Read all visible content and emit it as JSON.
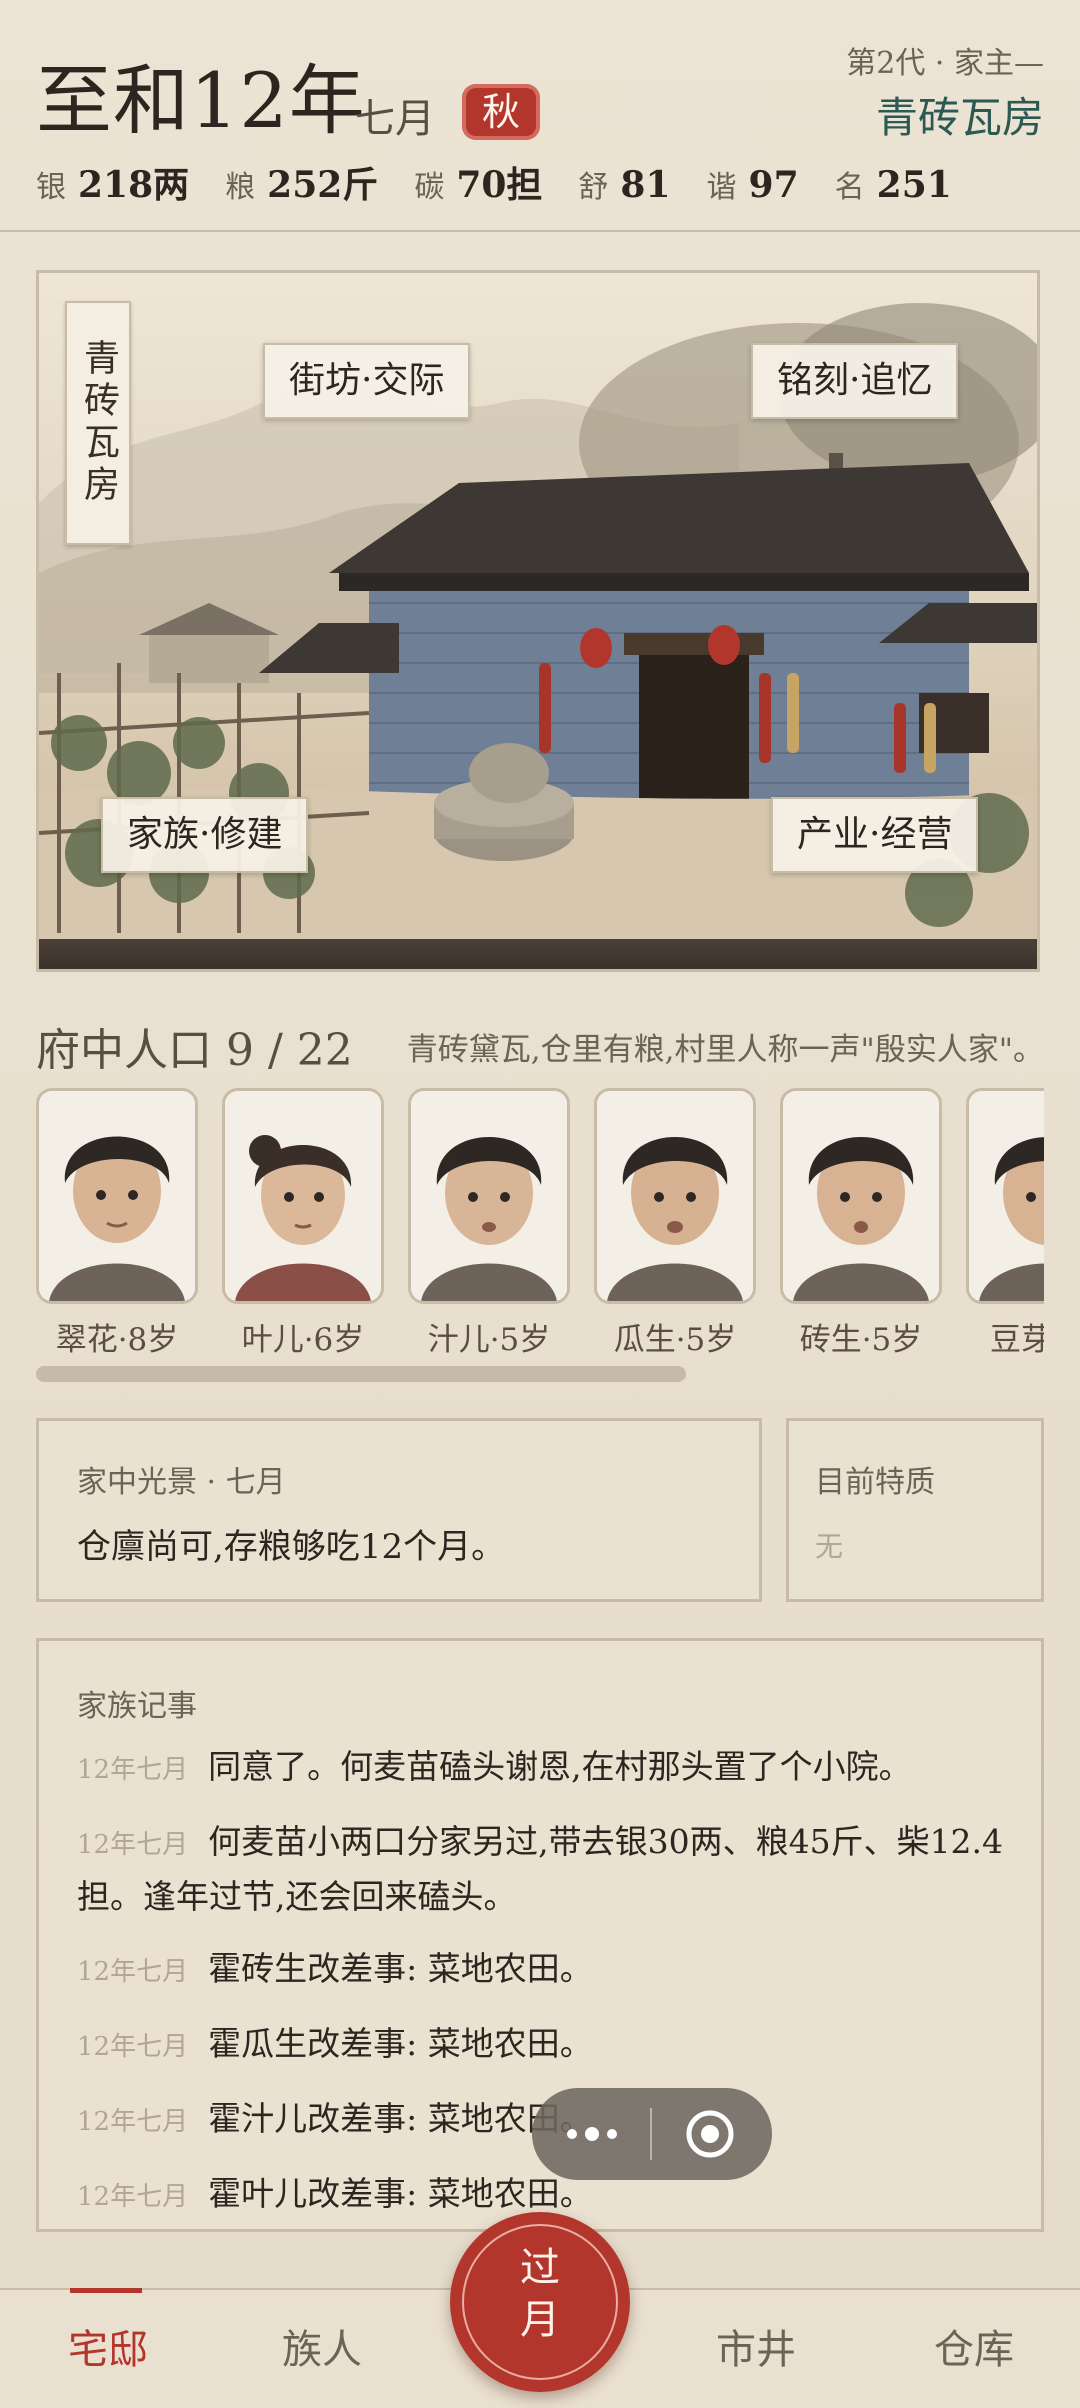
{
  "header": {
    "era": "至和12年",
    "month": "七月",
    "season": "秋",
    "generation": "第2代 · 家主—",
    "house_name": "青砖瓦房",
    "stats": [
      {
        "label": "银",
        "value": "218两"
      },
      {
        "label": "粮",
        "value": "252斤"
      },
      {
        "label": "碳",
        "value": "70担"
      },
      {
        "label": "舒",
        "value": "81"
      },
      {
        "label": "谐",
        "value": "97"
      },
      {
        "label": "名",
        "value": "251"
      }
    ]
  },
  "scene": {
    "vertical_sign": "青砖瓦房",
    "buttons": {
      "street": "街坊·交际",
      "memorial": "铭刻·追忆",
      "build": "家族·修建",
      "business": "产业·经营"
    }
  },
  "population": {
    "title": "府中人口 9 / 22",
    "description": "青砖黛瓦,仓里有粮,村里人称一声\"殷实人家\"。",
    "people": [
      {
        "name": "翠花·8岁"
      },
      {
        "name": "叶儿·6岁"
      },
      {
        "name": "汁儿·5岁"
      },
      {
        "name": "瓜生·5岁"
      },
      {
        "name": "砖生·5岁"
      },
      {
        "name": "豆芽"
      }
    ]
  },
  "status_card": {
    "label": "家中光景 · 七月",
    "text": "仓廪尚可,存粮够吃12个月。"
  },
  "trait_card": {
    "label": "目前特质",
    "value": "无"
  },
  "log": {
    "title": "家族记事",
    "entries": [
      {
        "date": "12年七月",
        "text": "同意了。何麦苗磕头谢恩,在村那头置了个小院。"
      },
      {
        "date": "12年七月",
        "text": "何麦苗小两口分家另过,带去银30两、粮45斤、柴12.4担。逢年过节,还会回来磕头。"
      },
      {
        "date": "12年七月",
        "text": "霍砖生改差事: 菜地农田。"
      },
      {
        "date": "12年七月",
        "text": "霍瓜生改差事: 菜地农田。"
      },
      {
        "date": "12年七月",
        "text": "霍汁儿改差事: 菜地农田。"
      },
      {
        "date": "12年七月",
        "text": "霍叶儿改差事: 菜地农田。"
      }
    ]
  },
  "nav": {
    "home": "宅邸",
    "clan": "族人",
    "advance": "过月",
    "market": "市井",
    "warehouse": "仓库"
  },
  "colors": {
    "accent_red": "#b3362c",
    "house_name_green": "#2c5a52",
    "background": "#ece4d4"
  }
}
